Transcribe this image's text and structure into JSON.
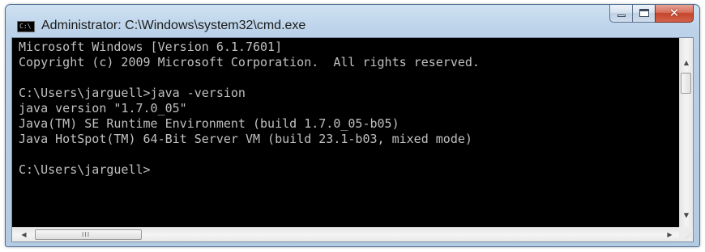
{
  "window": {
    "title": "Administrator: C:\\Windows\\system32\\cmd.exe",
    "icon": "cmd-icon",
    "icon_glyph": "C:\\"
  },
  "caption_buttons": {
    "minimize_icon": "minimize-icon",
    "maximize_icon": "maximize-icon",
    "close_icon": "close-icon",
    "close_glyph": "✕"
  },
  "console": {
    "lines": [
      "Microsoft Windows [Version 6.1.7601]",
      "Copyright (c) 2009 Microsoft Corporation.  All rights reserved.",
      "",
      "C:\\Users\\jarguell>java -version",
      "java version \"1.7.0_05\"",
      "Java(TM) SE Runtime Environment (build 1.7.0_05-b05)",
      "Java HotSpot(TM) 64-Bit Server VM (build 23.1-b03, mixed mode)",
      "",
      "C:\\Users\\jarguell>"
    ],
    "background": "#000000",
    "foreground": "#c0c0c0"
  },
  "scrollbars": {
    "up_arrow": "▲",
    "down_arrow": "▼",
    "left_arrow": "◀",
    "right_arrow": "▶",
    "grip": "III",
    "size_grip": "⋰"
  }
}
